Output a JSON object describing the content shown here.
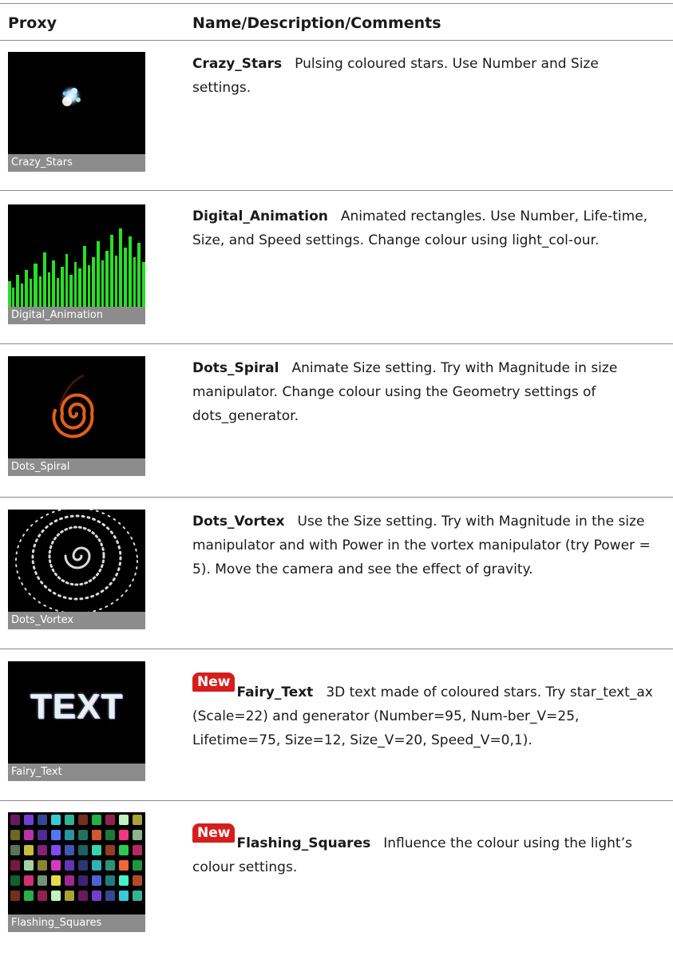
{
  "header": {
    "col1": "Proxy",
    "col2": "Name/Description/Comments"
  },
  "rows": [
    {
      "caption": "Crazy_Stars",
      "name": "Crazy_Stars",
      "desc": "Pulsing coloured stars. Use Number and Size settings."
    },
    {
      "caption": "Digital_Animation",
      "name": "Digital_Animation",
      "desc": "Animated rectangles. Use Number, Life-time, Size, and Speed settings. Change colour using light_col-our."
    },
    {
      "caption": "Dots_Spiral",
      "name": "Dots_Spiral",
      "desc": "Animate Size setting. Try with Magnitude in size manipulator. Change colour using the Geometry settings of dots_generator."
    },
    {
      "caption": "Dots_Vortex",
      "name": "Dots_Vortex",
      "desc": "Use the Size setting. Try with Magnitude in the size manipulator and with Power in the vortex manipulator (try Power = 5). Move the camera and see the effect of gravity."
    },
    {
      "caption": "Fairy_Text",
      "name": "Fairy_Text",
      "badge": "New",
      "thumb_text": "TEXT",
      "desc": "3D text made of coloured stars. Try star_text_ax (Scale=22) and generator (Number=95, Num-ber_V=25, Lifetime=75, Size=12, Size_V=20, Speed_V=0,1)."
    },
    {
      "caption": "Flashing_Squares",
      "name": "Flashing_Squares",
      "badge": "New",
      "desc": "Influence the colour using the light’s colour settings."
    }
  ]
}
